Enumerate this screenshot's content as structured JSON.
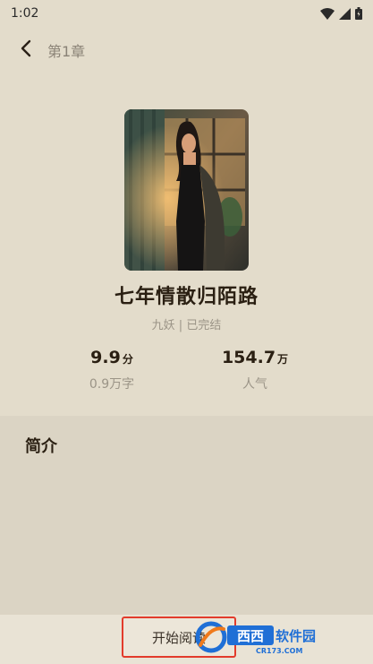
{
  "status_bar": {
    "time": "1:02",
    "icons": [
      "wifi-icon",
      "signal-icon",
      "battery-icon"
    ]
  },
  "top_bar": {
    "back_icon": "chevron-left-icon",
    "chapter_label": "第1章"
  },
  "book": {
    "title": "七年情散归陌路",
    "meta": "九妖 | 已完结",
    "score_value": "9.9",
    "score_unit": "分",
    "word_count": "0.9万字",
    "popularity_value": "154.7",
    "popularity_unit": "万",
    "popularity_label": "人气"
  },
  "intro": {
    "heading": "简介"
  },
  "bottom_bar": {
    "read_button_label": "开始阅读"
  },
  "watermark": {
    "brand_text": "西西软件园",
    "site_text": "CR173.COM"
  },
  "colors": {
    "background": "#e3dccb",
    "intro_panel": "#dbd4c4",
    "highlight_border": "#e23b2b",
    "watermark_blue": "#1f6fd6",
    "watermark_orange": "#f07a1b"
  }
}
